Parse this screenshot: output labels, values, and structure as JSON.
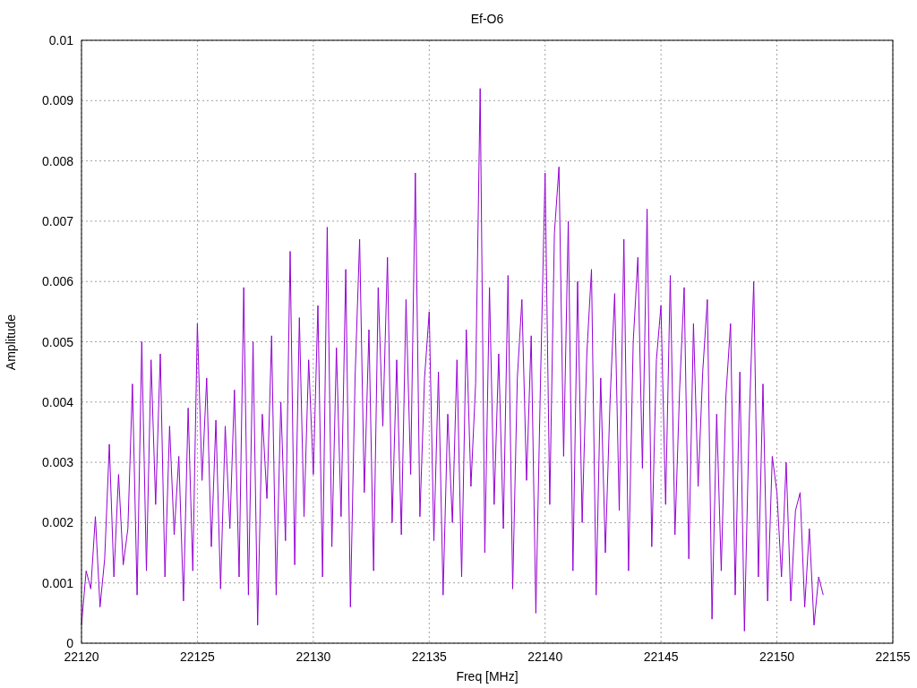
{
  "chart_data": {
    "type": "line",
    "title": "Ef-O6",
    "xlabel": "Freq [MHz]",
    "ylabel": "Amplitude",
    "xlim": [
      22120,
      22155
    ],
    "ylim": [
      0,
      0.01
    ],
    "grid": true,
    "xticks": [
      {
        "value": 22120,
        "label": "22120"
      },
      {
        "value": 22125,
        "label": "22125"
      },
      {
        "value": 22130,
        "label": "22130"
      },
      {
        "value": 22135,
        "label": "22135"
      },
      {
        "value": 22140,
        "label": "22140"
      },
      {
        "value": 22145,
        "label": "22145"
      },
      {
        "value": 22150,
        "label": "22150"
      },
      {
        "value": 22155,
        "label": "22155"
      }
    ],
    "yticks": [
      {
        "value": 0,
        "label": "0"
      },
      {
        "value": 0.001,
        "label": "0.001"
      },
      {
        "value": 0.002,
        "label": "0.002"
      },
      {
        "value": 0.003,
        "label": "0.003"
      },
      {
        "value": 0.004,
        "label": "0.004"
      },
      {
        "value": 0.005,
        "label": "0.005"
      },
      {
        "value": 0.006,
        "label": "0.006"
      },
      {
        "value": 0.007,
        "label": "0.007"
      },
      {
        "value": 0.008,
        "label": "0.008"
      },
      {
        "value": 0.009,
        "label": "0.009"
      },
      {
        "value": 0.01,
        "label": "0.01"
      }
    ],
    "x": [
      22120,
      22120.2,
      22120.4,
      22120.6,
      22120.8,
      22121,
      22121.2,
      22121.4,
      22121.6,
      22121.8,
      22122,
      22122.2,
      22122.4,
      22122.6,
      22122.8,
      22123,
      22123.2,
      22123.4,
      22123.6,
      22123.8,
      22124,
      22124.2,
      22124.4,
      22124.6,
      22124.8,
      22125,
      22125.2,
      22125.4,
      22125.6,
      22125.8,
      22126,
      22126.2,
      22126.4,
      22126.6,
      22126.8,
      22127,
      22127.2,
      22127.4,
      22127.6,
      22127.8,
      22128,
      22128.2,
      22128.4,
      22128.6,
      22128.8,
      22129,
      22129.2,
      22129.4,
      22129.6,
      22129.8,
      22130,
      22130.2,
      22130.4,
      22130.6,
      22130.8,
      22131,
      22131.2,
      22131.4,
      22131.6,
      22131.8,
      22132,
      22132.2,
      22132.4,
      22132.6,
      22132.8,
      22133,
      22133.2,
      22133.4,
      22133.6,
      22133.8,
      22134,
      22134.2,
      22134.4,
      22134.6,
      22134.8,
      22135,
      22135.2,
      22135.4,
      22135.6,
      22135.8,
      22136,
      22136.2,
      22136.4,
      22136.6,
      22136.8,
      22137,
      22137.2,
      22137.4,
      22137.6,
      22137.8,
      22138,
      22138.2,
      22138.4,
      22138.6,
      22138.8,
      22139,
      22139.2,
      22139.4,
      22139.6,
      22139.8,
      22140,
      22140.2,
      22140.4,
      22140.6,
      22140.8,
      22141,
      22141.2,
      22141.4,
      22141.6,
      22141.8,
      22142,
      22142.2,
      22142.4,
      22142.6,
      22142.8,
      22143,
      22143.2,
      22143.4,
      22143.6,
      22143.8,
      22144,
      22144.2,
      22144.4,
      22144.6,
      22144.8,
      22145,
      22145.2,
      22145.4,
      22145.6,
      22145.8,
      22146,
      22146.2,
      22146.4,
      22146.6,
      22146.8,
      22147,
      22147.2,
      22147.4,
      22147.6,
      22147.8,
      22148,
      22148.2,
      22148.4,
      22148.6,
      22148.8,
      22149,
      22149.2,
      22149.4,
      22149.6,
      22149.8,
      22150,
      22150.2,
      22150.4,
      22150.6,
      22150.8,
      22151,
      22151.2,
      22151.4,
      22151.6,
      22151.8,
      22152
    ],
    "series": [
      {
        "color": "#9400d3",
        "values": [
          0.0003,
          0.0012,
          0.0009,
          0.0021,
          0.0006,
          0.0014,
          0.0033,
          0.0011,
          0.0028,
          0.0013,
          0.0019,
          0.0043,
          0.0008,
          0.005,
          0.0012,
          0.0047,
          0.0023,
          0.0048,
          0.0011,
          0.0036,
          0.0018,
          0.0031,
          0.0007,
          0.0039,
          0.0012,
          0.0053,
          0.0027,
          0.0044,
          0.0016,
          0.0037,
          0.0009,
          0.0036,
          0.0019,
          0.0042,
          0.0011,
          0.0059,
          0.0008,
          0.005,
          0.0003,
          0.0038,
          0.0024,
          0.0051,
          0.0008,
          0.004,
          0.0017,
          0.0065,
          0.0013,
          0.0054,
          0.0021,
          0.0047,
          0.0028,
          0.0056,
          0.0011,
          0.0069,
          0.0016,
          0.0049,
          0.0021,
          0.0062,
          0.0006,
          0.0044,
          0.0067,
          0.0025,
          0.0052,
          0.0012,
          0.0059,
          0.0036,
          0.0064,
          0.002,
          0.0047,
          0.0018,
          0.0057,
          0.0028,
          0.0078,
          0.0021,
          0.0044,
          0.0055,
          0.0017,
          0.0045,
          0.0008,
          0.0038,
          0.002,
          0.0047,
          0.0011,
          0.0052,
          0.0026,
          0.0043,
          0.0092,
          0.0015,
          0.0059,
          0.0023,
          0.0048,
          0.0019,
          0.0061,
          0.0009,
          0.0044,
          0.0057,
          0.0027,
          0.0051,
          0.0005,
          0.0043,
          0.0078,
          0.0023,
          0.0068,
          0.0079,
          0.0031,
          0.007,
          0.0012,
          0.006,
          0.002,
          0.0048,
          0.0062,
          0.0008,
          0.0044,
          0.0015,
          0.004,
          0.0058,
          0.0022,
          0.0067,
          0.0012,
          0.005,
          0.0064,
          0.0029,
          0.0072,
          0.0016,
          0.0047,
          0.0056,
          0.0023,
          0.0061,
          0.0018,
          0.0042,
          0.0059,
          0.0014,
          0.0053,
          0.0026,
          0.0045,
          0.0057,
          0.0004,
          0.0038,
          0.0012,
          0.0041,
          0.0053,
          0.0008,
          0.0045,
          0.0002,
          0.0036,
          0.006,
          0.0011,
          0.0043,
          0.0007,
          0.0031,
          0.0025,
          0.0011,
          0.003,
          0.0007,
          0.0022,
          0.0025,
          0.0006,
          0.0019,
          0.0003,
          0.0011,
          0.0008
        ]
      }
    ]
  }
}
